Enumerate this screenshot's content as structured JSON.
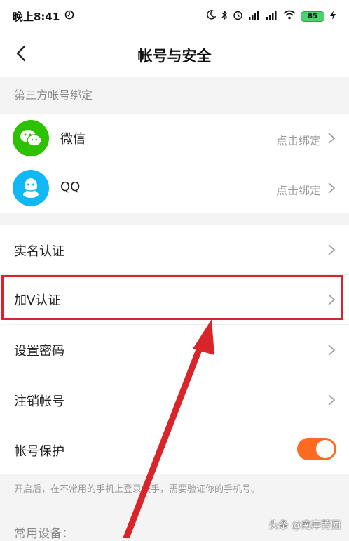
{
  "status_bar": {
    "time": "晚上8:41",
    "battery": "85",
    "icons": [
      "moon-icon",
      "bluetooth-icon",
      "alarm-icon",
      "signal-icon",
      "signal-icon",
      "wifi-icon",
      "battery-icon",
      "charging-icon"
    ]
  },
  "header": {
    "title": "帐号与安全",
    "back_icon": "chevron-left-icon"
  },
  "third_party": {
    "section_title": "第三方帐号绑定",
    "items": [
      {
        "label": "微信",
        "action": "点击绑定",
        "icon": "wechat-icon",
        "color": "#2dc100"
      },
      {
        "label": "QQ",
        "action": "点击绑定",
        "icon": "qq-icon",
        "color": "#12b7f5"
      }
    ]
  },
  "settings": {
    "items": [
      {
        "label": "实名认证"
      },
      {
        "label": "加V认证"
      },
      {
        "label": "设置密码"
      },
      {
        "label": "注销帐号"
      }
    ],
    "protection": {
      "label": "帐号保护",
      "enabled": true,
      "toggle_color": "#ff6a21"
    },
    "note": "开启后，在不常用的手机上登录快手，需要验证你的手机号。"
  },
  "devices": {
    "section_title": "常用设备："
  },
  "annotation": {
    "highlight_color": "#d9252a"
  },
  "watermark": "头条 @南岸菁园"
}
